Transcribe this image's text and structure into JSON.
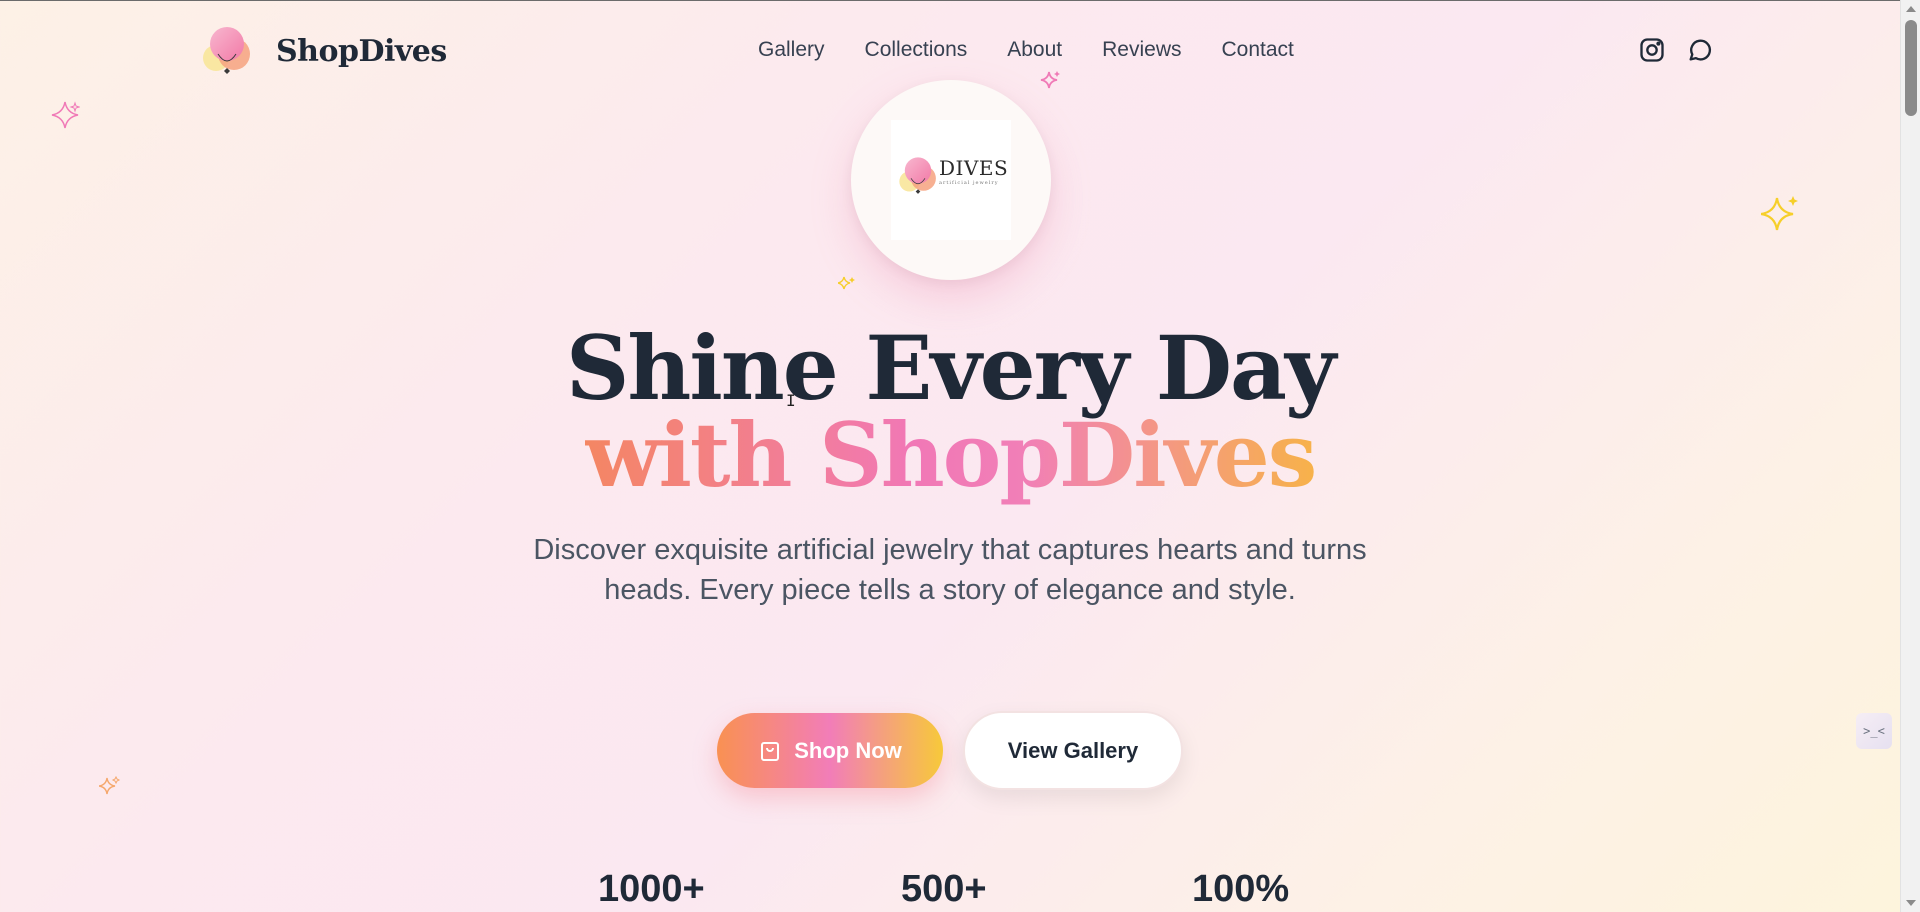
{
  "header": {
    "brand_name": "ShopDives",
    "nav": [
      "Gallery",
      "Collections",
      "About",
      "Reviews",
      "Contact"
    ],
    "social_icons": [
      "instagram-icon",
      "message-circle-icon"
    ]
  },
  "logo": {
    "wordmark": "DIVES",
    "tagline": "artificial jewelry"
  },
  "hero": {
    "title_line1": "Shine Every Day",
    "title_line2": "with ShopDives",
    "subtitle": "Discover exquisite artificial jewelry that captures hearts and turns heads. Every piece tells a story of elegance and style.",
    "shop_button": "Shop Now",
    "gallery_button": "View Gallery"
  },
  "stats": [
    "1000+",
    "500+",
    "100%"
  ],
  "side_widget": {
    "label": ">_<"
  },
  "colors": {
    "text_dark": "#1f2937",
    "gradient_orange": "#f48663",
    "gradient_pink": "#f178b6",
    "gradient_yellow": "#f7b24a",
    "sparkle_yellow": "#f6cf2a",
    "sparkle_pink": "#f07ab7"
  }
}
